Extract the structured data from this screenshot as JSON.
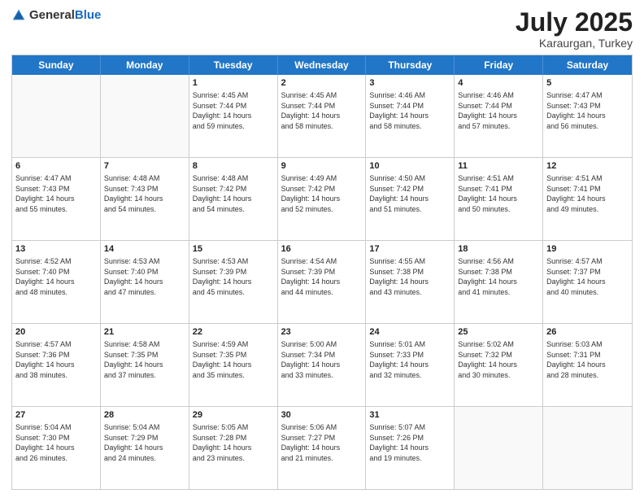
{
  "header": {
    "logo_general": "General",
    "logo_blue": "Blue",
    "title": "July 2025",
    "location": "Karaurgan, Turkey"
  },
  "weekdays": [
    "Sunday",
    "Monday",
    "Tuesday",
    "Wednesday",
    "Thursday",
    "Friday",
    "Saturday"
  ],
  "weeks": [
    [
      {
        "day": "",
        "lines": [],
        "empty": true
      },
      {
        "day": "",
        "lines": [],
        "empty": true
      },
      {
        "day": "1",
        "lines": [
          "Sunrise: 4:45 AM",
          "Sunset: 7:44 PM",
          "Daylight: 14 hours",
          "and 59 minutes."
        ],
        "empty": false
      },
      {
        "day": "2",
        "lines": [
          "Sunrise: 4:45 AM",
          "Sunset: 7:44 PM",
          "Daylight: 14 hours",
          "and 58 minutes."
        ],
        "empty": false
      },
      {
        "day": "3",
        "lines": [
          "Sunrise: 4:46 AM",
          "Sunset: 7:44 PM",
          "Daylight: 14 hours",
          "and 58 minutes."
        ],
        "empty": false
      },
      {
        "day": "4",
        "lines": [
          "Sunrise: 4:46 AM",
          "Sunset: 7:44 PM",
          "Daylight: 14 hours",
          "and 57 minutes."
        ],
        "empty": false
      },
      {
        "day": "5",
        "lines": [
          "Sunrise: 4:47 AM",
          "Sunset: 7:43 PM",
          "Daylight: 14 hours",
          "and 56 minutes."
        ],
        "empty": false
      }
    ],
    [
      {
        "day": "6",
        "lines": [
          "Sunrise: 4:47 AM",
          "Sunset: 7:43 PM",
          "Daylight: 14 hours",
          "and 55 minutes."
        ],
        "empty": false
      },
      {
        "day": "7",
        "lines": [
          "Sunrise: 4:48 AM",
          "Sunset: 7:43 PM",
          "Daylight: 14 hours",
          "and 54 minutes."
        ],
        "empty": false
      },
      {
        "day": "8",
        "lines": [
          "Sunrise: 4:48 AM",
          "Sunset: 7:42 PM",
          "Daylight: 14 hours",
          "and 54 minutes."
        ],
        "empty": false
      },
      {
        "day": "9",
        "lines": [
          "Sunrise: 4:49 AM",
          "Sunset: 7:42 PM",
          "Daylight: 14 hours",
          "and 52 minutes."
        ],
        "empty": false
      },
      {
        "day": "10",
        "lines": [
          "Sunrise: 4:50 AM",
          "Sunset: 7:42 PM",
          "Daylight: 14 hours",
          "and 51 minutes."
        ],
        "empty": false
      },
      {
        "day": "11",
        "lines": [
          "Sunrise: 4:51 AM",
          "Sunset: 7:41 PM",
          "Daylight: 14 hours",
          "and 50 minutes."
        ],
        "empty": false
      },
      {
        "day": "12",
        "lines": [
          "Sunrise: 4:51 AM",
          "Sunset: 7:41 PM",
          "Daylight: 14 hours",
          "and 49 minutes."
        ],
        "empty": false
      }
    ],
    [
      {
        "day": "13",
        "lines": [
          "Sunrise: 4:52 AM",
          "Sunset: 7:40 PM",
          "Daylight: 14 hours",
          "and 48 minutes."
        ],
        "empty": false
      },
      {
        "day": "14",
        "lines": [
          "Sunrise: 4:53 AM",
          "Sunset: 7:40 PM",
          "Daylight: 14 hours",
          "and 47 minutes."
        ],
        "empty": false
      },
      {
        "day": "15",
        "lines": [
          "Sunrise: 4:53 AM",
          "Sunset: 7:39 PM",
          "Daylight: 14 hours",
          "and 45 minutes."
        ],
        "empty": false
      },
      {
        "day": "16",
        "lines": [
          "Sunrise: 4:54 AM",
          "Sunset: 7:39 PM",
          "Daylight: 14 hours",
          "and 44 minutes."
        ],
        "empty": false
      },
      {
        "day": "17",
        "lines": [
          "Sunrise: 4:55 AM",
          "Sunset: 7:38 PM",
          "Daylight: 14 hours",
          "and 43 minutes."
        ],
        "empty": false
      },
      {
        "day": "18",
        "lines": [
          "Sunrise: 4:56 AM",
          "Sunset: 7:38 PM",
          "Daylight: 14 hours",
          "and 41 minutes."
        ],
        "empty": false
      },
      {
        "day": "19",
        "lines": [
          "Sunrise: 4:57 AM",
          "Sunset: 7:37 PM",
          "Daylight: 14 hours",
          "and 40 minutes."
        ],
        "empty": false
      }
    ],
    [
      {
        "day": "20",
        "lines": [
          "Sunrise: 4:57 AM",
          "Sunset: 7:36 PM",
          "Daylight: 14 hours",
          "and 38 minutes."
        ],
        "empty": false
      },
      {
        "day": "21",
        "lines": [
          "Sunrise: 4:58 AM",
          "Sunset: 7:35 PM",
          "Daylight: 14 hours",
          "and 37 minutes."
        ],
        "empty": false
      },
      {
        "day": "22",
        "lines": [
          "Sunrise: 4:59 AM",
          "Sunset: 7:35 PM",
          "Daylight: 14 hours",
          "and 35 minutes."
        ],
        "empty": false
      },
      {
        "day": "23",
        "lines": [
          "Sunrise: 5:00 AM",
          "Sunset: 7:34 PM",
          "Daylight: 14 hours",
          "and 33 minutes."
        ],
        "empty": false
      },
      {
        "day": "24",
        "lines": [
          "Sunrise: 5:01 AM",
          "Sunset: 7:33 PM",
          "Daylight: 14 hours",
          "and 32 minutes."
        ],
        "empty": false
      },
      {
        "day": "25",
        "lines": [
          "Sunrise: 5:02 AM",
          "Sunset: 7:32 PM",
          "Daylight: 14 hours",
          "and 30 minutes."
        ],
        "empty": false
      },
      {
        "day": "26",
        "lines": [
          "Sunrise: 5:03 AM",
          "Sunset: 7:31 PM",
          "Daylight: 14 hours",
          "and 28 minutes."
        ],
        "empty": false
      }
    ],
    [
      {
        "day": "27",
        "lines": [
          "Sunrise: 5:04 AM",
          "Sunset: 7:30 PM",
          "Daylight: 14 hours",
          "and 26 minutes."
        ],
        "empty": false
      },
      {
        "day": "28",
        "lines": [
          "Sunrise: 5:04 AM",
          "Sunset: 7:29 PM",
          "Daylight: 14 hours",
          "and 24 minutes."
        ],
        "empty": false
      },
      {
        "day": "29",
        "lines": [
          "Sunrise: 5:05 AM",
          "Sunset: 7:28 PM",
          "Daylight: 14 hours",
          "and 23 minutes."
        ],
        "empty": false
      },
      {
        "day": "30",
        "lines": [
          "Sunrise: 5:06 AM",
          "Sunset: 7:27 PM",
          "Daylight: 14 hours",
          "and 21 minutes."
        ],
        "empty": false
      },
      {
        "day": "31",
        "lines": [
          "Sunrise: 5:07 AM",
          "Sunset: 7:26 PM",
          "Daylight: 14 hours",
          "and 19 minutes."
        ],
        "empty": false
      },
      {
        "day": "",
        "lines": [],
        "empty": true
      },
      {
        "day": "",
        "lines": [],
        "empty": true
      }
    ]
  ]
}
